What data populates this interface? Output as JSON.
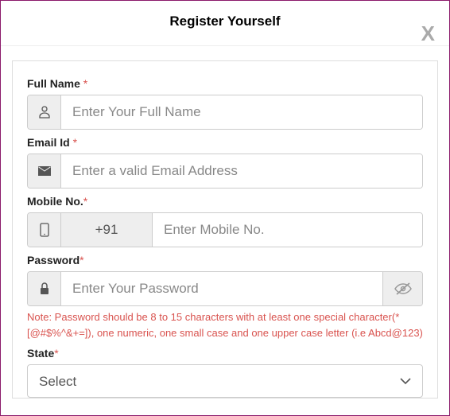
{
  "header": {
    "title": "Register Yourself",
    "close_label": "X"
  },
  "form": {
    "fullName": {
      "label": "Full Name ",
      "required": "*",
      "placeholder": "Enter Your Full Name",
      "value": ""
    },
    "email": {
      "label": "Email Id ",
      "required": "*",
      "placeholder": "Enter a valid Email Address",
      "value": ""
    },
    "mobile": {
      "label": "Mobile No.",
      "required": "*",
      "prefix": "+91",
      "placeholder": "Enter Mobile No.",
      "value": ""
    },
    "password": {
      "label": "Password",
      "required": "*",
      "placeholder": "Enter Your Password",
      "value": "",
      "note": "Note: Password should be 8 to 15 characters with at least one special character(* [@#$%^&+=]), one numeric, one small case and one upper case letter (i.e Abcd@123)"
    },
    "state": {
      "label": "State",
      "required": "*",
      "selected": "Select"
    }
  }
}
